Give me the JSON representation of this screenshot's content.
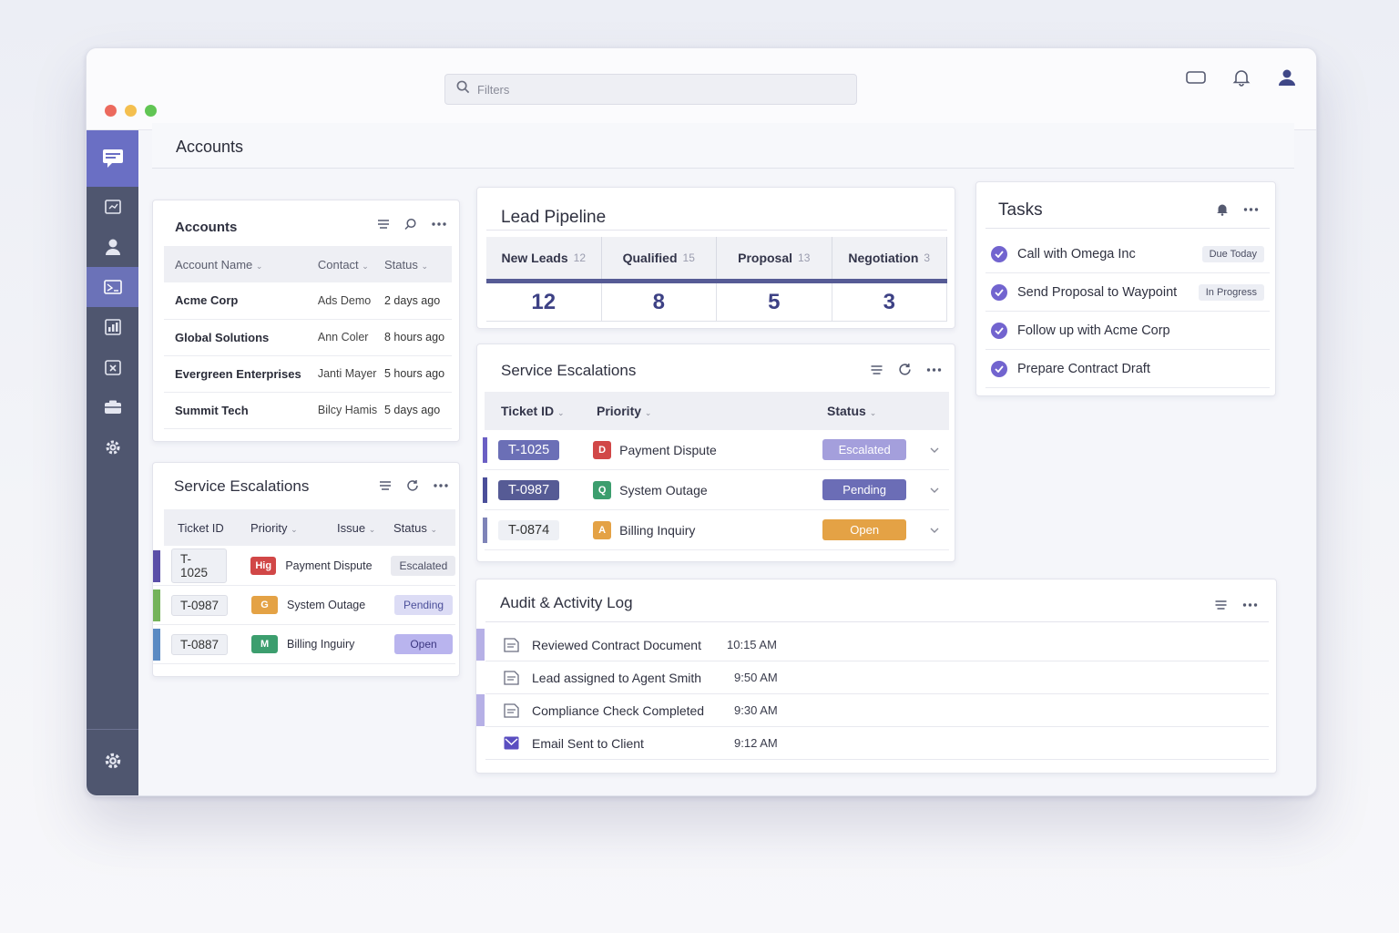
{
  "search": {
    "placeholder": "Filters"
  },
  "page": {
    "title": "Accounts"
  },
  "accounts": {
    "title": "Accounts",
    "columns": [
      "Account Name",
      "Contact",
      "Status"
    ],
    "rows": [
      {
        "name": "Acme Corp",
        "contact": "Ads Demo",
        "status": "2 days ago"
      },
      {
        "name": "Global Solutions",
        "contact": "Ann Coler",
        "status": "8 hours ago"
      },
      {
        "name": "Evergreen Enterprises",
        "contact": "Janti Mayer",
        "status": "5 hours ago"
      },
      {
        "name": "Summit Tech",
        "contact": "Bilcy Hamis",
        "status": "5 days ago"
      }
    ]
  },
  "escalations_small": {
    "title": "Service Escalations",
    "columns": [
      "Ticket ID",
      "Priority",
      "Issue",
      "Status"
    ],
    "rows": [
      {
        "id": "T-1025",
        "prio": "Hig",
        "issue": "Payment Dispute",
        "status": "Escalated",
        "color": "#d14747",
        "accent": "#5a4ea8",
        "pill_bg": "#e9eaf0",
        "pill_fg": "#4a4d62"
      },
      {
        "id": "T-0987",
        "prio": "G",
        "issue": "System Outage",
        "status": "Pending",
        "color": "#e4a245",
        "accent": "#73b35a",
        "pill_bg": "#dcdcf5",
        "pill_fg": "#4b4f9a"
      },
      {
        "id": "T-0887",
        "prio": "M",
        "issue": "Billing Inguiry",
        "status": "Open",
        "color": "#3c9e6e",
        "accent": "#5a8ac3",
        "pill_bg": "#b9b4ee",
        "pill_fg": "#3b3680"
      }
    ]
  },
  "pipeline": {
    "title": "Lead Pipeline",
    "stages": [
      {
        "label": "New Leads",
        "count": "12",
        "value": "12"
      },
      {
        "label": "Qualified",
        "count": "15",
        "value": "8"
      },
      {
        "label": "Proposal",
        "count": "13",
        "value": "5"
      },
      {
        "label": "Negotiation",
        "count": "3",
        "value": "3"
      }
    ]
  },
  "escalations_main": {
    "title": "Service Escalations",
    "columns": [
      "Ticket ID",
      "Priority",
      "Status"
    ],
    "rows": [
      {
        "id": "T-1025",
        "prio": "D",
        "issue": "Payment Dispute",
        "status": "Escalated",
        "color": "#d14747",
        "accent": "#6b5fc4",
        "id_bg": "#6b6fb6",
        "id_fg": "#ffffff",
        "pill_bg": "#a49fdc",
        "pill_fg": "#ffffff"
      },
      {
        "id": "T-0987",
        "prio": "Q",
        "issue": "System Outage",
        "status": "Pending",
        "color": "#3c9e6e",
        "accent": "#4b4f9a",
        "id_bg": "#565b95",
        "id_fg": "#ffffff",
        "pill_bg": "#6b6db6",
        "pill_fg": "#ffffff"
      },
      {
        "id": "T-0874",
        "prio": "A",
        "issue": "Billing Inquiry",
        "status": "Open",
        "color": "#e4a245",
        "accent": "#7f84b8",
        "id_bg": "#eef0f5",
        "id_fg": "#333333",
        "pill_bg": "#e4a245",
        "pill_fg": "#ffffff"
      }
    ]
  },
  "tasks": {
    "title": "Tasks",
    "items": [
      {
        "label": "Call with Omega Inc",
        "badge": "Due Today"
      },
      {
        "label": "Send Proposal to Waypoint",
        "badge": "In Progress"
      },
      {
        "label": "Follow up with Acme Corp",
        "badge": ""
      },
      {
        "label": "Prepare Contract Draft",
        "badge": ""
      }
    ]
  },
  "audit": {
    "title": "Audit & Activity Log",
    "items": [
      {
        "label": "Reviewed Contract Document",
        "time": "10:15 AM",
        "icon": "document-icon"
      },
      {
        "label": "Lead assigned to Agent Smith",
        "time": "9:50 AM",
        "icon": "document-icon"
      },
      {
        "label": "Compliance Check Completed",
        "time": "9:30 AM",
        "icon": "document-icon"
      },
      {
        "label": "Email Sent to Client",
        "time": "9:12 AM",
        "icon": "email-icon"
      }
    ]
  },
  "sidebar": {
    "items": [
      "brand-icon",
      "dashboard-icon",
      "user-icon",
      "inbox-icon",
      "reports-icon",
      "tickets-icon",
      "billing-icon",
      "settings-icon"
    ]
  },
  "colors": {
    "accent": "#6b6fb6",
    "sidebar": "#4f566f",
    "brand": "#6a6fc4"
  }
}
